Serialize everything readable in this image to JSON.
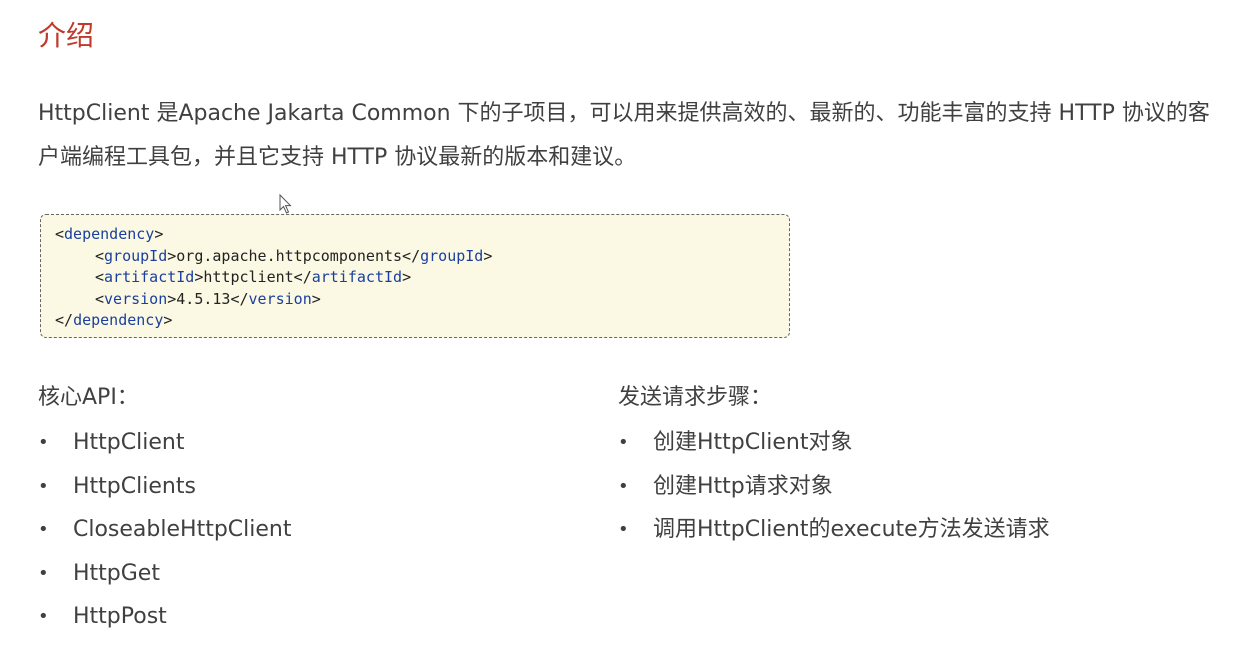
{
  "slide": {
    "title": "介绍",
    "intro": "HttpClient 是Apache Jakarta Common 下的子项目，可以用来提供高效的、最新的、功能丰富的支持 HTTP 协议的客户端编程工具包，并且它支持 HTTP 协议最新的版本和建议。"
  },
  "code": {
    "line1_open": "<",
    "line1_tag": "dependency",
    "line1_close": ">",
    "line2_open": "<",
    "line2_tag": "groupId",
    "line2_mid": ">org.apache.httpcomponents</",
    "line2_tag2": "groupId",
    "line2_close": ">",
    "line3_open": "<",
    "line3_tag": "artifactId",
    "line3_mid": ">httpclient</",
    "line3_tag2": "artifactId",
    "line3_close": ">",
    "line4_open": "<",
    "line4_tag": "version",
    "line4_mid": ">4.5.13</",
    "line4_tag2": "version",
    "line4_close": ">",
    "line5_open": "</",
    "line5_tag": "dependency",
    "line5_close": ">"
  },
  "core_api": {
    "heading": "核心API：",
    "items": [
      "HttpClient",
      "HttpClients",
      "CloseableHttpClient",
      "HttpGet",
      "HttpPost"
    ]
  },
  "steps": {
    "heading": "发送请求步骤：",
    "items": [
      "创建HttpClient对象",
      "创建Http请求对象",
      "调用HttpClient的execute方法发送请求"
    ]
  },
  "bullet_char": "•",
  "colors": {
    "title": "#c0392b",
    "code_bg": "#fbf9e3",
    "code_tag": "#1a3f9e",
    "body_text": "#404040"
  },
  "icons": {
    "cursor": "mouse-pointer-icon"
  }
}
